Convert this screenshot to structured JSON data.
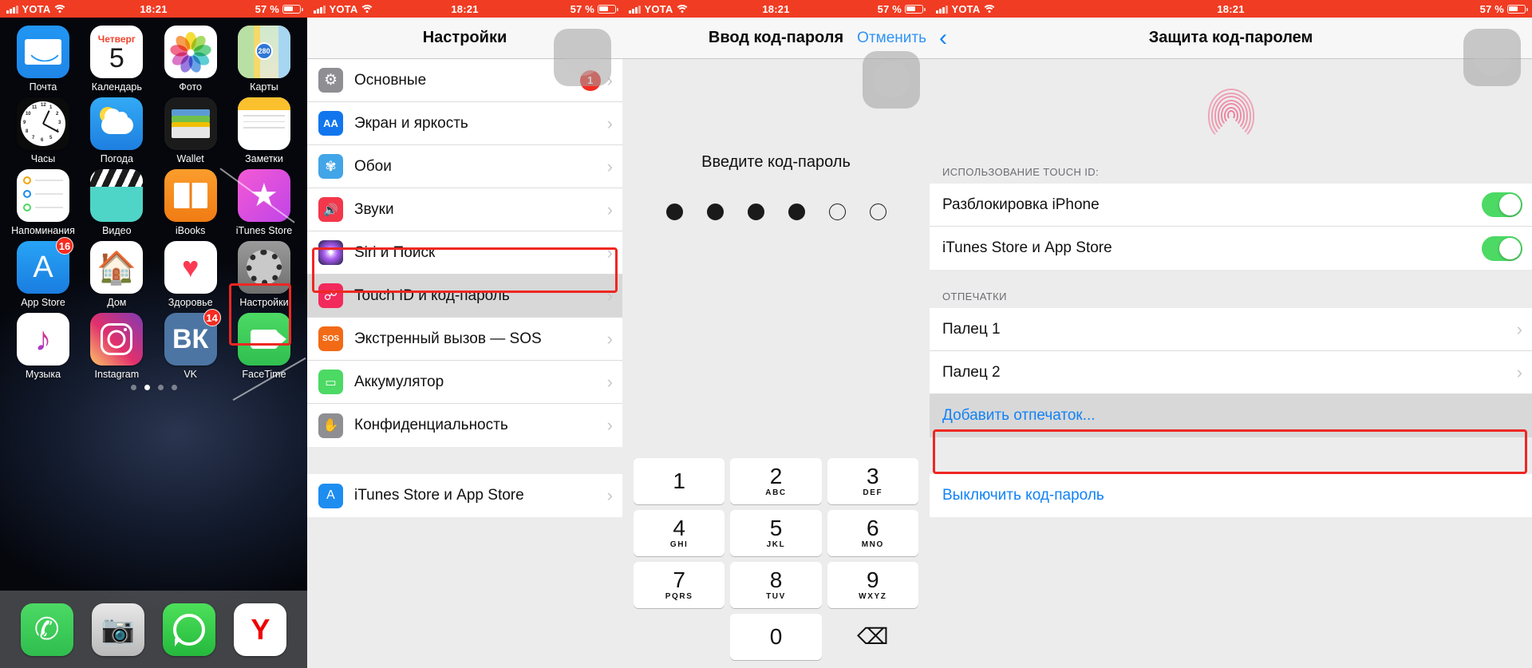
{
  "status_bar": {
    "carrier": "YOTA",
    "time": "18:21",
    "battery_percent": "57 %",
    "signal_icon": "cellular-bars-icon",
    "wifi_icon": "wifi-icon",
    "battery_icon": "battery-icon"
  },
  "panel1": {
    "name": "home-screen",
    "page_dots": 4,
    "active_page": 2,
    "rows": [
      [
        {
          "label": "Почта",
          "icon": "mail-icon"
        },
        {
          "label": "Календарь",
          "icon": "calendar-icon",
          "dow": "Четверг",
          "day": "5"
        },
        {
          "label": "Фото",
          "icon": "photos-icon"
        },
        {
          "label": "Карты",
          "icon": "maps-icon",
          "route": "280"
        }
      ],
      [
        {
          "label": "Часы",
          "icon": "clock-icon"
        },
        {
          "label": "Погода",
          "icon": "weather-icon"
        },
        {
          "label": "Wallet",
          "icon": "wallet-icon"
        },
        {
          "label": "Заметки",
          "icon": "notes-icon"
        }
      ],
      [
        {
          "label": "Напоминания",
          "icon": "reminders-icon"
        },
        {
          "label": "Видео",
          "icon": "videos-icon"
        },
        {
          "label": "iBooks",
          "icon": "ibooks-icon"
        },
        {
          "label": "iTunes Store",
          "icon": "itunes-store-icon"
        }
      ],
      [
        {
          "label": "App Store",
          "icon": "app-store-icon",
          "badge": "16"
        },
        {
          "label": "Дом",
          "icon": "home-app-icon"
        },
        {
          "label": "Здоровье",
          "icon": "health-icon"
        },
        {
          "label": "Настройки",
          "icon": "settings-gear-icon",
          "highlight": true
        }
      ],
      [
        {
          "label": "Музыка",
          "icon": "music-icon"
        },
        {
          "label": "Instagram",
          "icon": "instagram-icon"
        },
        {
          "label": "VK",
          "icon": "vk-icon",
          "badge": "14"
        },
        {
          "label": "FaceTime",
          "icon": "facetime-icon"
        }
      ]
    ],
    "dock": [
      {
        "label": "Телефон",
        "icon": "phone-icon"
      },
      {
        "label": "Камера",
        "icon": "camera-icon"
      },
      {
        "label": "WhatsApp",
        "icon": "whatsapp-icon"
      },
      {
        "label": "Яндекс",
        "icon": "yandex-icon"
      }
    ]
  },
  "panel2": {
    "name": "settings-list",
    "title": "Настройки",
    "items": [
      {
        "label": "Основные",
        "icon": "gear-icon",
        "badge": "1",
        "color": "#8e8e93"
      },
      {
        "label": "Экран и яркость",
        "icon": "display-brightness-icon",
        "color": "#1176ee",
        "glyph": "AA"
      },
      {
        "label": "Обои",
        "icon": "wallpaper-icon",
        "color": "#42a5e8"
      },
      {
        "label": "Звуки",
        "icon": "sounds-icon",
        "color": "#f3374b",
        "glyph": "◀)))"
      },
      {
        "label": "Siri и Поиск",
        "icon": "siri-icon",
        "color": "#1c1c3a"
      },
      {
        "label": "Touch ID и код-пароль",
        "icon": "touch-id-icon",
        "color": "#f2295b",
        "selected": true
      },
      {
        "label": "Экстренный вызов — SOS",
        "icon": "sos-icon",
        "color": "#f26a16",
        "glyph": "SOS"
      },
      {
        "label": "Аккумулятор",
        "icon": "battery-icon",
        "color": "#4cd964"
      },
      {
        "label": "Конфиденциальность",
        "icon": "privacy-hand-icon",
        "color": "#8e8e93",
        "glyph": "✋"
      }
    ],
    "items2": [
      {
        "label": "iTunes Store и App Store",
        "icon": "app-store-icon",
        "color": "#1d8df0"
      }
    ]
  },
  "panel3": {
    "name": "passcode-entry",
    "title": "Ввод код-пароля",
    "cancel_label": "Отменить",
    "prompt": "Введите код-пароль",
    "dots_total": 6,
    "dots_filled": 4,
    "keys": [
      {
        "digit": "1",
        "letters": ""
      },
      {
        "digit": "2",
        "letters": "ABC"
      },
      {
        "digit": "3",
        "letters": "DEF"
      },
      {
        "digit": "4",
        "letters": "GHI"
      },
      {
        "digit": "5",
        "letters": "JKL"
      },
      {
        "digit": "6",
        "letters": "MNO"
      },
      {
        "digit": "7",
        "letters": "PQRS"
      },
      {
        "digit": "8",
        "letters": "TUV"
      },
      {
        "digit": "9",
        "letters": "WXYZ"
      },
      {
        "digit": "",
        "letters": ""
      },
      {
        "digit": "0",
        "letters": ""
      },
      {
        "digit": "⌫",
        "letters": ""
      }
    ]
  },
  "panel4": {
    "name": "passcode-protection",
    "title": "Защита код-паролем",
    "back_icon": "chevron-left-icon",
    "fingerprint_icon": "fingerprint-icon",
    "section1_header": "ИСПОЛЬЗОВАНИЕ TOUCH ID:",
    "toggles": [
      {
        "label": "Разблокировка iPhone",
        "on": true
      },
      {
        "label": "iTunes Store и App Store",
        "on": true
      }
    ],
    "section2_header": "ОТПЕЧАТКИ",
    "fingers": [
      {
        "label": "Палец 1"
      },
      {
        "label": "Палец 2"
      }
    ],
    "add_fingerprint": "Добавить отпечаток...",
    "disable_passcode": "Выключить код-пароль"
  },
  "colors": {
    "status_red": "#f03c23",
    "ios_blue": "#1182f6",
    "highlight_red": "#ee2722",
    "switch_green": "#4cd964"
  }
}
